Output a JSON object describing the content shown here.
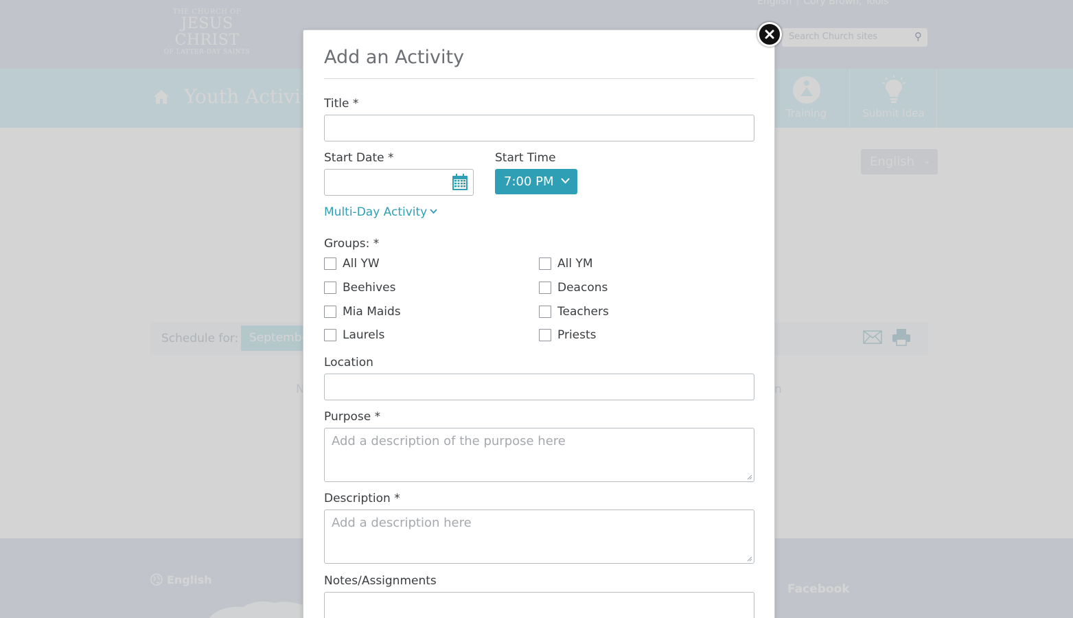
{
  "background": {
    "logo": {
      "line1": "THE CHURCH OF",
      "line2": "JESUS CHRIST",
      "line3": "OF LATTER-DAY SAINTS"
    },
    "util_links": {
      "language": "English",
      "user": "Cory Brown, Tools"
    },
    "search": {
      "placeholder": "Search Church sites"
    },
    "site_title": "Youth Activit",
    "nav": [
      {
        "label": "Training",
        "icon": "training-icon"
      },
      {
        "label": "Submit Idea",
        "icon": "lightbulb-icon"
      }
    ],
    "language_select": "English",
    "schedule": {
      "label": "Schedule for:",
      "value": "Septembe"
    },
    "faint_left": "N",
    "faint_right": "n",
    "footer": {
      "language": "English",
      "facebook": "Facebook"
    }
  },
  "modal": {
    "title": "Add an Activity",
    "title_field": {
      "label": "Title *",
      "value": ""
    },
    "start_date": {
      "label": "Start Date *",
      "value": ""
    },
    "start_time": {
      "label": "Start Time",
      "value": "7:00 PM"
    },
    "multi_day_link": "Multi-Day Activity",
    "groups": {
      "label": "Groups: *",
      "left": [
        "All YW",
        "Beehives",
        "Mia Maids",
        "Laurels"
      ],
      "right": [
        "All YM",
        "Deacons",
        "Teachers",
        "Priests"
      ]
    },
    "location": {
      "label": "Location",
      "value": ""
    },
    "purpose": {
      "label": "Purpose *",
      "placeholder": "Add a description of the purpose here"
    },
    "description": {
      "label": "Description *",
      "placeholder": "Add a description here"
    },
    "notes": {
      "label": "Notes/Assignments",
      "value": ""
    }
  },
  "colors": {
    "accent": "#2f9fb6",
    "nav_band": "#e4f6fb",
    "header": "#e9edf4"
  }
}
